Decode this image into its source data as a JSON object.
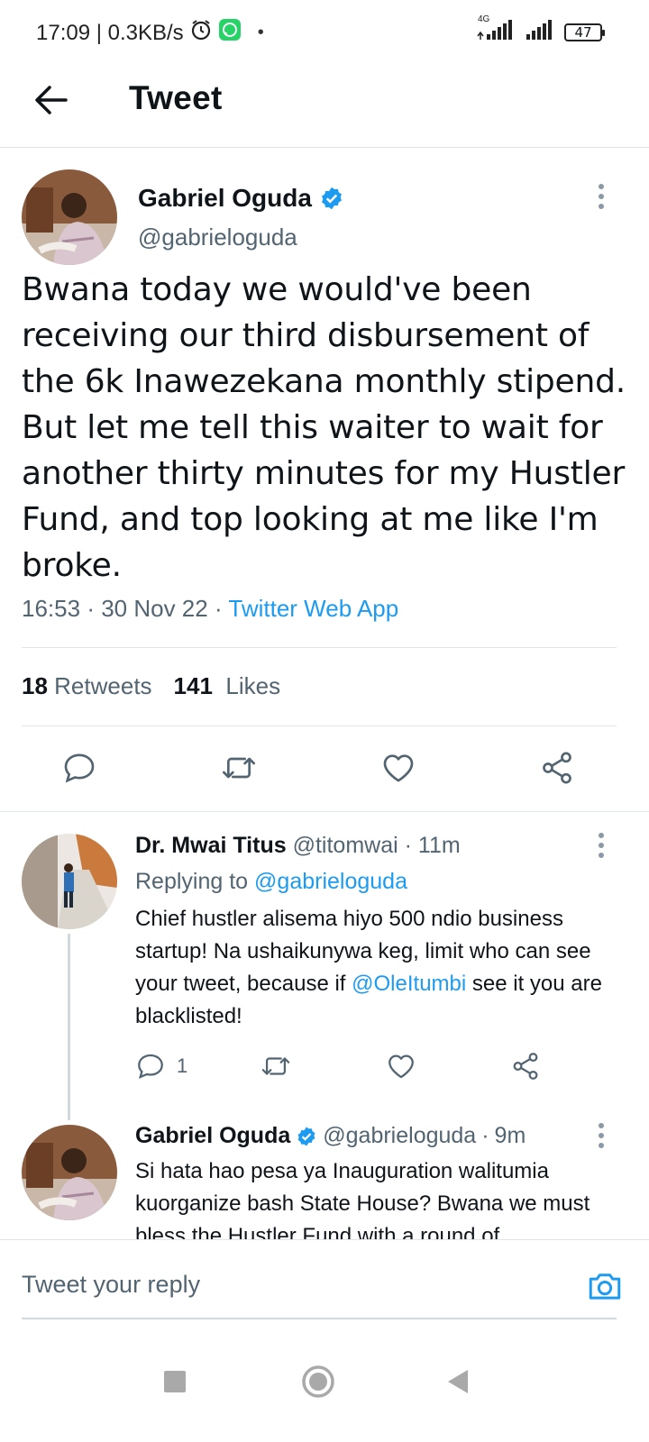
{
  "status_bar": {
    "time_speed": "17:09 | 0.3KB/s",
    "network": "4G",
    "battery": "47"
  },
  "app_bar": {
    "title": "Tweet"
  },
  "main_tweet": {
    "author_name": "Gabriel Oguda",
    "handle": "@gabrieloguda",
    "text": "Bwana today we would've been receiving our third disbursement of the 6k Inawezekana monthly stipend. But let me tell this waiter to wait for another thirty minutes for my Hustler Fund, and top looking at me like I'm broke.",
    "time": "16:53",
    "date": "30 Nov 22",
    "source": "Twitter Web App",
    "retweets_count": "18",
    "retweets_label": "Retweets",
    "likes_count": "141",
    "likes_label": "Likes"
  },
  "replies": [
    {
      "author_name": "Dr. Mwai Titus",
      "handle": "@titomwai",
      "time": "11m",
      "replying_prefix": "Replying to",
      "replying_to": "@gabrieloguda",
      "text_part1": "Chief hustler alisema hiyo 500 ndio business startup! Na ushaikunywa keg, limit who can see your tweet, because if ",
      "mention": "@OleItumbi",
      "text_part2": " see it you are blacklisted!",
      "reply_count": "1"
    },
    {
      "author_name": "Gabriel Oguda",
      "handle": "@gabrieloguda",
      "time": "9m",
      "text": "Si hata hao pesa ya Inauguration walitumia kuorganize bash State House? Bwana we must bless the Hustler Fund with a round of"
    }
  ],
  "compose": {
    "placeholder": "Tweet your reply"
  },
  "colors": {
    "accent": "#1d9bf0",
    "text": "#0f1419",
    "muted": "#536471",
    "divider": "#e1e5e8"
  },
  "icons": [
    "back-arrow-icon",
    "verified-badge-icon",
    "more-options-icon",
    "reply-icon",
    "retweet-icon",
    "like-icon",
    "share-icon",
    "camera-icon",
    "nav-recents-icon",
    "nav-home-icon",
    "nav-back-icon",
    "alarm-icon",
    "whatsapp-icon",
    "signal-icon"
  ]
}
